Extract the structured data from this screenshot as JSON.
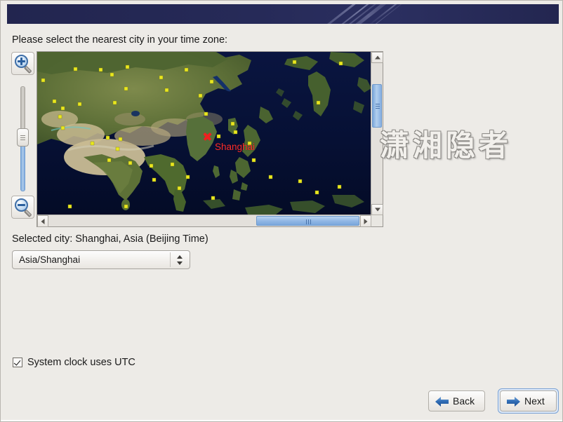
{
  "window": {
    "background_color": "#edebe7",
    "banner_color": "#23264f"
  },
  "prompt": {
    "label": "Please select the nearest city in your time zone:"
  },
  "map_controls": {
    "zoom_in_tooltip": "Zoom in",
    "zoom_out_tooltip": "Zoom out",
    "zoom_in_icon": "magnifier-plus-icon",
    "zoom_out_icon": "magnifier-minus-icon",
    "slider_orientation": "vertical"
  },
  "map": {
    "marker": {
      "city": "Shanghai",
      "label": "Shanghai",
      "color": "#ff2d2d",
      "icon": "red-cross-marker-icon"
    },
    "city_dot_color": "#e9e81f",
    "ocean_color": "#061034",
    "scroll": {
      "vertical_up_icon": "chevron-up-icon",
      "vertical_down_icon": "chevron-down-icon",
      "horizontal_left_icon": "chevron-left-icon",
      "horizontal_right_icon": "chevron-right-icon"
    }
  },
  "watermark": {
    "text": "潇湘隐者"
  },
  "selection": {
    "selected_city_text": "Selected city: Shanghai, Asia (Beijing Time)",
    "timezone_value": "Asia/Shanghai"
  },
  "options": {
    "utc_label": "System clock uses UTC",
    "utc_checked": true
  },
  "navigation": {
    "back_label": "Back",
    "next_label": "Next",
    "back_icon": "arrow-left-icon",
    "next_icon": "arrow-right-icon",
    "accent_color": "#2d6bb5"
  }
}
